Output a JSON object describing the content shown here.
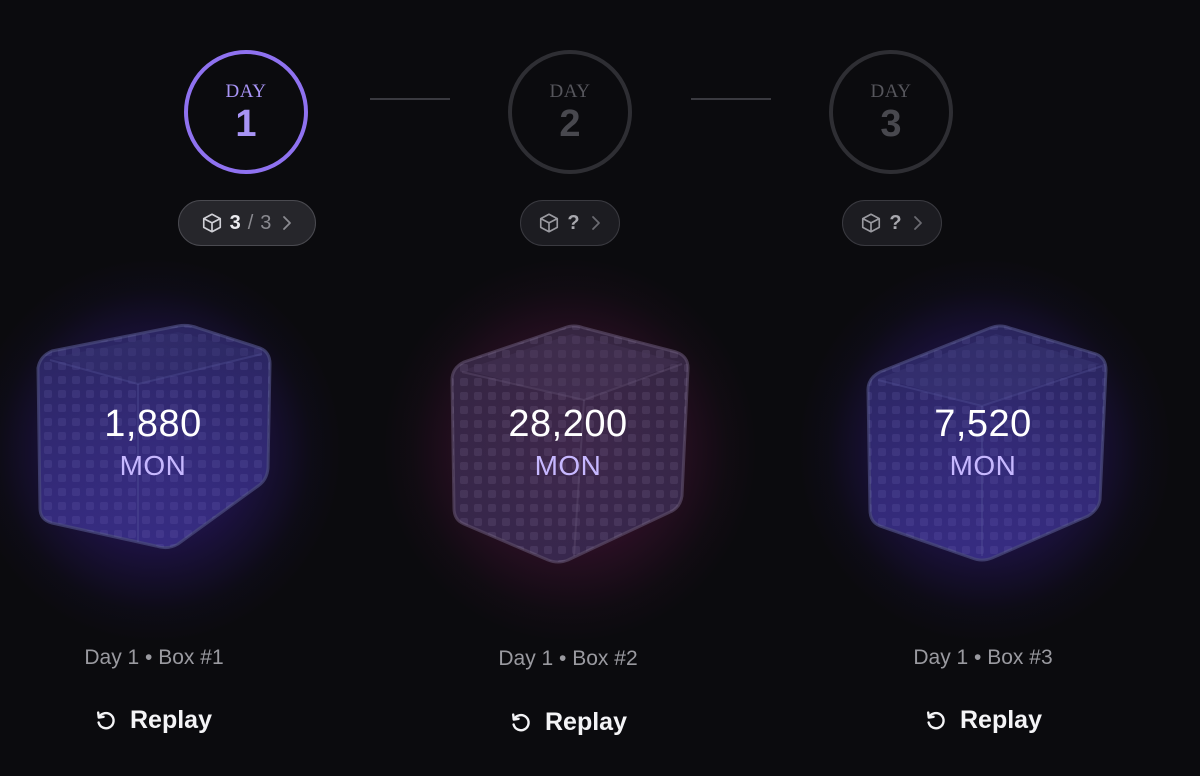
{
  "days": [
    {
      "word": "DAY",
      "number": "1",
      "state": "active"
    },
    {
      "word": "DAY",
      "number": "2",
      "state": "inactive"
    },
    {
      "word": "DAY",
      "number": "3",
      "state": "inactive"
    }
  ],
  "pills": [
    {
      "icon": "cube-icon",
      "count": "3",
      "separator": "/",
      "total": "3",
      "chevron": "chevron-right-icon"
    },
    {
      "icon": "cube-icon",
      "count": "?",
      "chevron": "chevron-right-icon"
    },
    {
      "icon": "cube-icon",
      "count": "?",
      "chevron": "chevron-right-icon"
    }
  ],
  "boxes": [
    {
      "amount": "1,880",
      "unit": "MON",
      "caption": "Day 1 • Box #1",
      "glow_color": "#5a2fd6"
    },
    {
      "amount": "28,200",
      "unit": "MON",
      "caption": "Day 1 • Box #2",
      "glow_color": "#a81e6e"
    },
    {
      "amount": "7,520",
      "unit": "MON",
      "caption": "Day 1 • Box #3",
      "glow_color": "#5a2fd6"
    }
  ],
  "replay": {
    "label": "Replay",
    "icon": "replay-icon"
  },
  "colors": {
    "accent": "#8f72f0",
    "unit_text": "#c7b8ff",
    "background": "#0b0b0e"
  }
}
